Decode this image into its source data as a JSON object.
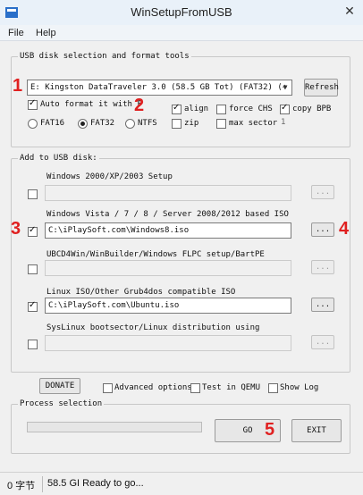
{
  "window": {
    "title": "WinSetupFromUSB",
    "close_glyph": "✕"
  },
  "menu": [
    {
      "label": "File"
    },
    {
      "label": "Help"
    }
  ],
  "usb_tools": {
    "group_title": "USB disk selection and format tools",
    "disk_value": "E: Kingston DataTraveler 3.0 (58.5 GB Tot) (FAT32) (+",
    "refresh_label": "Refresh",
    "auto_format": {
      "label": "Auto format it with F",
      "checked": true
    },
    "fs_options": [
      {
        "label": "FAT16",
        "selected": false
      },
      {
        "label": "FAT32",
        "selected": true
      },
      {
        "label": "NTFS",
        "selected": false
      }
    ],
    "align": {
      "label": "align",
      "checked": true
    },
    "force_chs": {
      "label": "force CHS",
      "checked": false
    },
    "copy_bpb": {
      "label": "copy BPB",
      "checked": true
    },
    "zip": {
      "label": "zip",
      "checked": false
    },
    "max_sector": {
      "label": "max sector",
      "checked": false,
      "value": "1"
    }
  },
  "add_to_usb": {
    "group_title": "Add to USB disk:",
    "browse_label": "...",
    "sources": [
      {
        "label": "Windows 2000/XP/2003 Setup",
        "checked": false,
        "path": "",
        "enabled": false
      },
      {
        "label": "Windows Vista / 7 / 8 / Server 2008/2012 based ISO",
        "checked": true,
        "path": "C:\\iPlaySoft.com\\Windows8.iso",
        "enabled": true
      },
      {
        "label": "UBCD4Win/WinBuilder/Windows FLPC setup/BartPE",
        "checked": false,
        "path": "",
        "enabled": false
      },
      {
        "label": "Linux ISO/Other Grub4dos compatible ISO",
        "checked": true,
        "path": "C:\\iPlaySoft.com\\Ubuntu.iso",
        "enabled": true
      },
      {
        "label": "SysLinux bootsector/Linux distribution using",
        "checked": false,
        "path": "",
        "enabled": false
      }
    ]
  },
  "bottom": {
    "donate_label": "DONATE",
    "advanced_options": {
      "label": "Advanced options",
      "checked": false
    },
    "test_in_qemu": {
      "label": "Test in QEMU",
      "checked": false
    },
    "show_log": {
      "label": "Show Log",
      "checked": false
    },
    "process_title": "Process selection",
    "progress_fraction": 0,
    "go_label": "GO",
    "exit_label": "EXIT"
  },
  "status": {
    "left": "0 字节",
    "right": "58.5 GI Ready to go..."
  },
  "annotations": [
    "1",
    "2",
    "3",
    "4",
    "5"
  ],
  "colors": {
    "annotation": "#e02020",
    "window_bg": "#e8f0f8",
    "client_bg": "#f0f0f0"
  }
}
